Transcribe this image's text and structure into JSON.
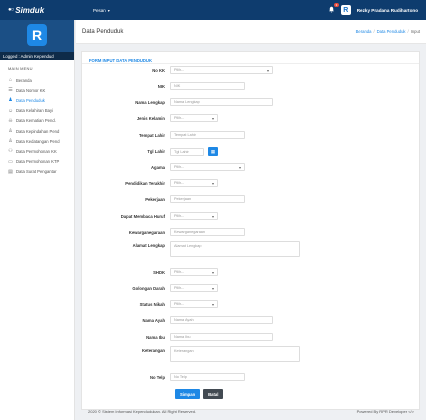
{
  "app": {
    "logo_text": "Simduk",
    "menu_label": "Pesan",
    "notification_count": "3",
    "user_initial": "R",
    "user_name": "Rezky Pradana Rudihartono"
  },
  "sidebar": {
    "avatar_initial": "R",
    "profile_label": "Logged : Admin Kependud",
    "menu_title": "MAIN MENU",
    "items": [
      {
        "label": "Beranda",
        "icon": "home-icon"
      },
      {
        "label": "Data Nomor KK",
        "icon": "database-icon"
      },
      {
        "label": "Data Penduduk",
        "icon": "user-tie-icon",
        "active": true
      },
      {
        "label": "Data Kelahiran Bayi",
        "icon": "baby-icon"
      },
      {
        "label": "Data Kematian Pend.",
        "icon": "skull-icon"
      },
      {
        "label": "Data Kepindahan Pend",
        "icon": "user-plus-icon"
      },
      {
        "label": "Data Kedatangan Pend",
        "icon": "user-plus-icon"
      },
      {
        "label": "Data Permohonan KK",
        "icon": "users-icon"
      },
      {
        "label": "Data Permohonan KTP",
        "icon": "id-card-icon"
      },
      {
        "label": "Data Surat Pengantar",
        "icon": "file-icon"
      }
    ]
  },
  "header": {
    "title": "Data Penduduk",
    "breadcrumb": [
      "Beranda",
      "Data Penduduk",
      "Input"
    ]
  },
  "form": {
    "title": "FORM INPUT DATA PENDUDUK",
    "fields": [
      {
        "label": "No KK",
        "placeholder": "Pilih--",
        "type": "select"
      },
      {
        "label": "NIK",
        "placeholder": "NIK",
        "type": "text"
      },
      {
        "label": "Nama Lengkap",
        "placeholder": "Nama Lengkap",
        "type": "text"
      },
      {
        "label": "Jenis Kelamin",
        "placeholder": "Pilih--",
        "type": "select"
      },
      {
        "label": "Tempat Lahir",
        "placeholder": "Tempat Lahir",
        "type": "text"
      },
      {
        "label": "Tgl Lahir",
        "placeholder": "Tgl Lahir",
        "type": "date"
      },
      {
        "label": "Agama",
        "placeholder": "Pilih--",
        "type": "select"
      },
      {
        "label": "Pendidikan Terakhir",
        "placeholder": "Pilih--",
        "type": "select"
      },
      {
        "label": "Pekerjaan",
        "placeholder": "Pekerjaan",
        "type": "text"
      },
      {
        "label": "Dapat Membaca Huruf",
        "placeholder": "Pilih--",
        "type": "select"
      },
      {
        "label": "Kewarganegaraan",
        "placeholder": "Kewarganegaraan",
        "type": "text"
      },
      {
        "label": "Alamat Lengkap",
        "placeholder": "Alamat Lengkap",
        "type": "textarea"
      },
      {
        "label": "SHDK",
        "placeholder": "Pilih--",
        "type": "select"
      },
      {
        "label": "Golongan Darah",
        "placeholder": "Pilih--",
        "type": "select"
      },
      {
        "label": "Status Nikah",
        "placeholder": "Pilih--",
        "type": "select"
      },
      {
        "label": "Nama Ayah",
        "placeholder": "Nama Ayah",
        "type": "text"
      },
      {
        "label": "Nama Ibu",
        "placeholder": "Nama Ibu",
        "type": "text"
      },
      {
        "label": "Keterangan",
        "placeholder": "Keterangan",
        "type": "textarea"
      },
      {
        "label": "No Telp",
        "placeholder": "No Telp",
        "type": "text"
      }
    ],
    "save_label": "Simpan",
    "cancel_label": "Batal"
  },
  "footer": {
    "copyright": "2020 © Sistem Informasi Kependudukan. All Right Reserved.",
    "powered": "Powered By RPR Developer </>"
  },
  "colors": {
    "topbar": "#0e3c6e",
    "accent": "#1e88e5"
  }
}
